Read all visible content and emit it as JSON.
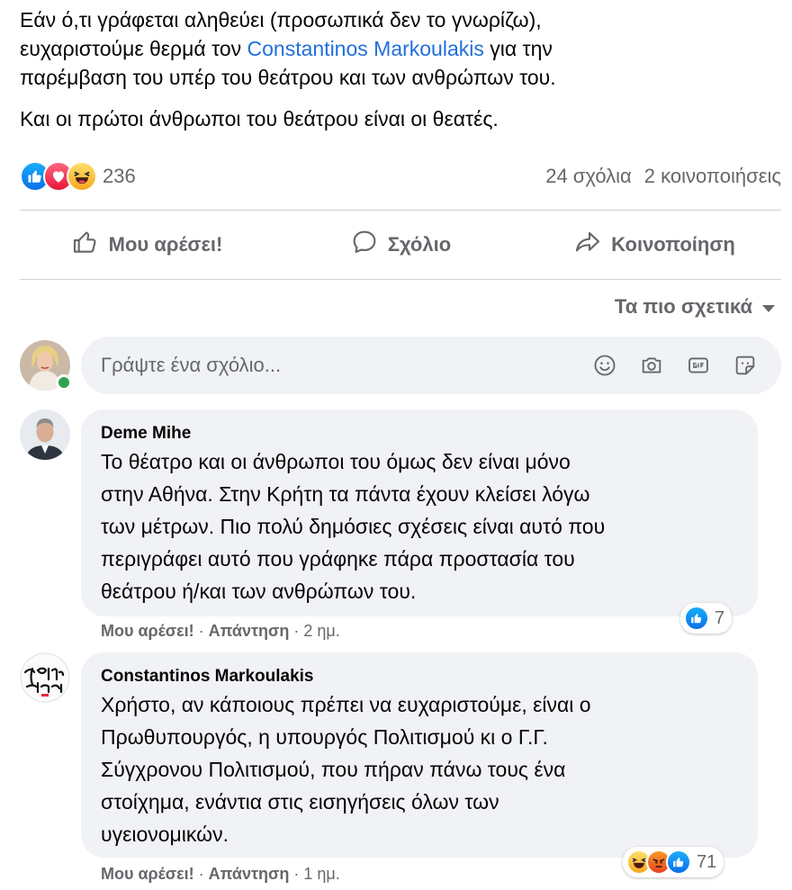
{
  "post": {
    "line1_prefix": "Εάν ό,τι γράφεται αληθεύει (προσωπικά δεν το γνωρίζω),",
    "line2_prefix": "ευχαριστούμε θερμά τον ",
    "mention": "Constantinos Markoulakis",
    "line2_suffix": " για την",
    "line3": "παρέμβαση του υπέρ του θεάτρου και των ανθρώπων του.",
    "paragraph2": "Και οι πρώτοι άνθρωποι του θεάτρου είναι οι θεατές.",
    "mention_color": "#216fdb"
  },
  "stats": {
    "reaction_icons": [
      "like-icon",
      "love-icon",
      "haha-icon"
    ],
    "reaction_count": "236",
    "comments_label": "24 σχόλια",
    "shares_label": "2 κοινοποιήσεις"
  },
  "actions": {
    "like_label": "Μου αρέσει!",
    "comment_label": "Σχόλιο",
    "share_label": "Κοινοποίηση"
  },
  "sort": {
    "label": "Τα πιο σχετικά",
    "icon": "caret-down-icon"
  },
  "composer": {
    "placeholder": "Γράψτε ένα σχόλιο...",
    "icons": [
      "emoji-icon",
      "camera-icon",
      "gif-icon",
      "sticker-icon"
    ],
    "online_color": "#31a24c"
  },
  "comments": [
    {
      "author": "Deme Mihe",
      "lines": [
        "Το θέατρο και οι άνθρωποι του όμως δεν είναι μόνο",
        "στην Αθήνα. Στην Κρήτη τα πάντα έχουν κλείσει λόγω",
        "των μέτρων. Πιο πολύ δημόσιες σχέσεις είναι αυτό που",
        "περιγράφει αυτό που γράφηκε πάρα προστασία του",
        "θεάτρου ή/και των ανθρώπων του."
      ],
      "like_label": "Μου αρέσει!",
      "reply_label": "Απάντηση",
      "time": "2 ημ.",
      "reaction_icons": [
        "like-icon"
      ],
      "reaction_count": "7"
    },
    {
      "author": "Constantinos Markoulakis",
      "lines": [
        "Χρήστο, αν κάποιους πρέπει να ευχαριστούμε, είναι ο",
        "Πρωθυπουργός, η υπουργός Πολιτισμού κι ο Γ.Γ.",
        "Σύγχρονου Πολιτισμού, που πήραν πάνω τους ένα",
        "στοίχημα, ενάντια στις εισηγήσεις όλων των",
        "υγειονομικών."
      ],
      "like_label": "Μου αρέσει!",
      "reply_label": "Απάντηση",
      "time": "1 ημ.",
      "reaction_icons": [
        "haha-icon",
        "angry-icon",
        "like-icon"
      ],
      "reaction_count": "71"
    }
  ],
  "separator": " · "
}
